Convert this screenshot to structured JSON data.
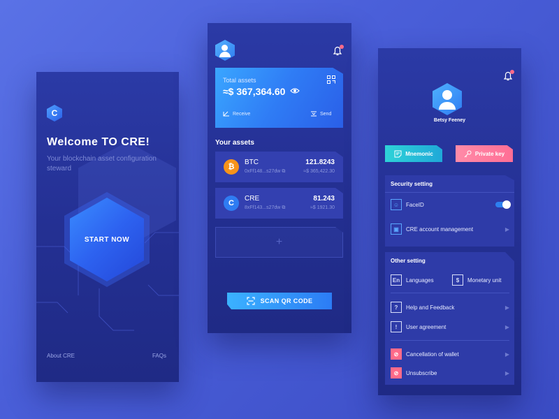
{
  "welcome_screen": {
    "logo_letter": "C",
    "title": "Welcome TO CRE!",
    "subtitle": "Your blockchain asset configuration steward",
    "start_button": "START NOW",
    "footer": {
      "about": "About CRE",
      "faqs": "FAQs"
    }
  },
  "wallet_screen": {
    "total_assets_label": "Total assets",
    "total_assets_value": "≈$ 367,364.60",
    "receive_label": "Receive",
    "send_label": "Send",
    "your_assets_title": "Your assets",
    "coins": [
      {
        "symbol": "₿",
        "name": "BTC",
        "address": "0xFf148...s27dw",
        "balance": "121.8243",
        "fiat": "≈$ 365,422.30",
        "color": "#f7931a"
      },
      {
        "symbol": "C",
        "name": "CRE",
        "address": "8xFf143...s27dw",
        "balance": "81.243",
        "fiat": "≈$ 1921.30",
        "color": "#2f7cf2"
      }
    ],
    "add_symbol": "+",
    "scan_button": "SCAN QR CODE"
  },
  "profile_screen": {
    "user_name": "Betsy Feeney",
    "mnemonic_label": "Mnemonic",
    "private_key_label": "Private key",
    "security_title": "Security setting",
    "faceid_label": "FaceID",
    "faceid_enabled": true,
    "account_mgmt_label": "CRE account management",
    "other_title": "Other setting",
    "languages_label": "Languages",
    "languages_icon": "En",
    "monetary_label": "Monetary unit",
    "monetary_icon": "$",
    "help_label": "Help and Feedback",
    "help_icon": "?",
    "agreement_label": "User agreement",
    "agreement_icon": "!",
    "cancel_wallet_label": "Cancellation of wallet",
    "unsubscribe_label": "Unsubscribe"
  },
  "colors": {
    "accent_blue": "#2f7cf2",
    "accent_pink": "#ff6b8a",
    "accent_teal": "#2ed3d8"
  }
}
